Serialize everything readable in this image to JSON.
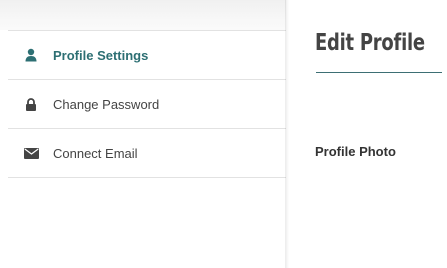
{
  "sidebar": {
    "items": [
      {
        "label": "Profile Settings",
        "icon": "user-icon",
        "active": true
      },
      {
        "label": "Change Password",
        "icon": "lock-icon",
        "active": false
      },
      {
        "label": "Connect Email",
        "icon": "envelope-icon",
        "active": false
      }
    ]
  },
  "main": {
    "title": "Edit Profile",
    "section_label": "Profile Photo"
  },
  "colors": {
    "accent": "#2d6f73",
    "text": "#444444",
    "border": "#e2e2e2"
  }
}
